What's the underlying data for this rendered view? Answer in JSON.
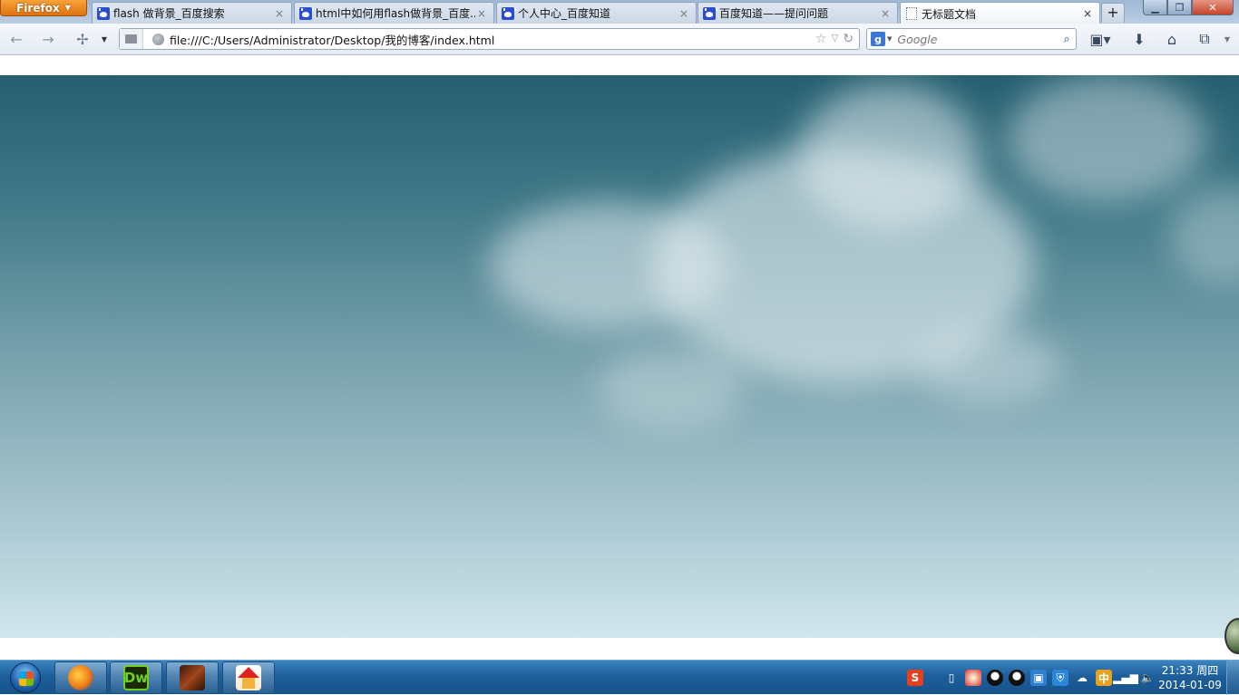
{
  "browser": {
    "menu_button": "Firefox",
    "tabs": [
      {
        "label": "flash 做背景_百度搜索",
        "icon": "baidu-paw-icon"
      },
      {
        "label": "html中如何用flash做背景_百度...",
        "icon": "baidu-paw-icon"
      },
      {
        "label": "个人中心_百度知道",
        "icon": "baidu-paw-icon"
      },
      {
        "label": "百度知道——提问问题",
        "icon": "baidu-paw-icon"
      },
      {
        "label": "无标题文档",
        "icon": "blank-page-icon",
        "active": true
      }
    ],
    "tab_close_glyph": "×",
    "new_tab_glyph": "+",
    "url": "file:///C:/Users/Administrator/Desktop/我的博客/index.html",
    "search": {
      "placeholder": "Google",
      "value": ""
    }
  },
  "page": {
    "background_colors": {
      "top": "#255f70",
      "middle": "#7ba4af",
      "bottom": "#d0e6ec"
    }
  },
  "taskbar": {
    "apps": [
      {
        "name": "Firefox",
        "icon": "firefox-icon"
      },
      {
        "name": "Dreamweaver",
        "icon": "dreamweaver-icon",
        "text": "Dw"
      },
      {
        "name": "Violin",
        "icon": "violin-app-icon"
      },
      {
        "name": "House",
        "icon": "house-app-icon"
      }
    ],
    "tray": {
      "sogou": "S",
      "ime": "中"
    },
    "clock": {
      "time": "21:33 周四",
      "date": "2014-01-09"
    }
  }
}
